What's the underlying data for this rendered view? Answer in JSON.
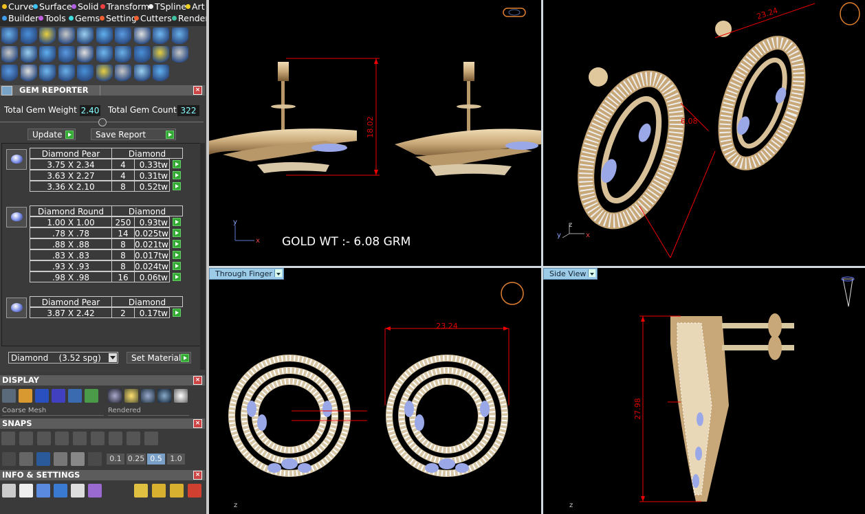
{
  "menu": [
    {
      "label": "Curve",
      "color": "#f0c020"
    },
    {
      "label": "Surface",
      "color": "#40c0f0"
    },
    {
      "label": "Solid",
      "color": "#b060e0"
    },
    {
      "label": "Transform",
      "color": "#f04040"
    },
    {
      "label": "TSpline",
      "color": "#f0f0f0"
    },
    {
      "label": "Art",
      "color": "#f0d020"
    },
    {
      "label": "Builder",
      "color": "#40a0f0"
    },
    {
      "label": "Tools",
      "color": "#c060e0"
    },
    {
      "label": "Gems",
      "color": "#40e0e0"
    },
    {
      "label": "Setting",
      "color": "#f06030"
    },
    {
      "label": "Cutters",
      "color": "#f06030"
    },
    {
      "label": "Render",
      "color": "#40c0a0"
    }
  ],
  "gem_reporter": {
    "title": "GEM REPORTER",
    "total_weight_label": "Total Gem Weight",
    "total_weight": "2.40",
    "total_count_label": "Total Gem Count",
    "total_count": "322",
    "update_label": "Update",
    "save_label": "Save Report",
    "groups": [
      {
        "shape": "Diamond Pear",
        "material": "Diamond",
        "rows": [
          {
            "size": "3.75 X 2.34",
            "count": "4",
            "weight": "0.33tw"
          },
          {
            "size": "3.63 X 2.27",
            "count": "4",
            "weight": "0.31tw"
          },
          {
            "size": "3.36 X 2.10",
            "count": "8",
            "weight": "0.52tw"
          }
        ]
      },
      {
        "shape": "Diamond Round",
        "material": "Diamond",
        "rows": [
          {
            "size": "1.00 X 1.00",
            "count": "250",
            "weight": "0.93tw"
          },
          {
            "size": ".78 X .78",
            "count": "14",
            "weight": "0.025tw"
          },
          {
            "size": ".88 X .88",
            "count": "8",
            "weight": "0.021tw"
          },
          {
            "size": ".83 X .83",
            "count": "8",
            "weight": "0.017tw"
          },
          {
            "size": ".93 X .93",
            "count": "8",
            "weight": "0.024tw"
          },
          {
            "size": ".98 X .98",
            "count": "16",
            "weight": "0.06tw"
          }
        ]
      },
      {
        "shape": "Diamond Pear",
        "material": "Diamond",
        "rows": [
          {
            "size": "3.87 X 2.42",
            "count": "2",
            "weight": "0.17tw"
          }
        ]
      }
    ],
    "material_select": "Diamond    (3.52 spg)",
    "set_material_label": "Set Material"
  },
  "display": {
    "title": "DISPLAY",
    "mesh": "Coarse Mesh",
    "render_mode": "Rendered"
  },
  "snaps": {
    "title": "SNAPS",
    "values": [
      "0.1",
      "0.25",
      "0.5",
      "1.0"
    ]
  },
  "info": {
    "title": "INFO & SETTINGS"
  },
  "viewports": {
    "top_left": {
      "note": "GOLD WT :- 6.08 GRM",
      "dim": "18.02"
    },
    "top_right": {
      "dim_a": "23.24",
      "dim_b": "6.08"
    },
    "bottom_left": {
      "label": "Through Finger",
      "dim": "23.24"
    },
    "bottom_right": {
      "label": "Side View",
      "dim": "27.98"
    }
  },
  "axes": {
    "x": "x",
    "y": "y",
    "z": "z"
  },
  "colors": {
    "gold": "#c8a878",
    "gem": "#9aa8e8",
    "dim": "#e00000",
    "viewport_label": "#9ccbe8"
  }
}
